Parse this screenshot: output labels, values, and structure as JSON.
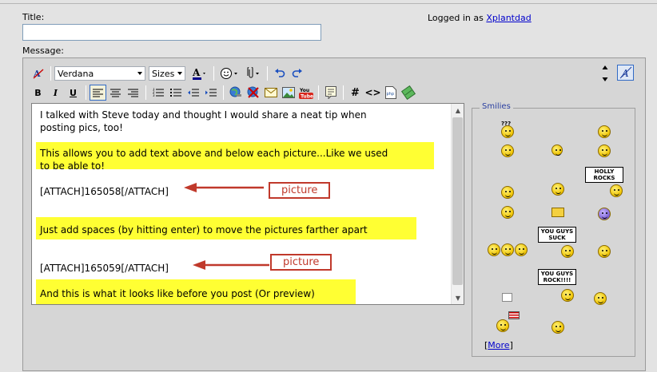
{
  "form": {
    "title_label": "Title:",
    "title_value": "",
    "message_label": "Message:",
    "logged_in_prefix": "Logged in as",
    "username": "Xplantdad"
  },
  "toolbar": {
    "font_name": "Verdana",
    "font_size": "Sizes",
    "bold": "B",
    "italic": "I",
    "underline": "U",
    "hash": "#",
    "code": "<>"
  },
  "message": {
    "line1a": "I talked with Steve today and thought I would share  a neat tip when",
    "line1b": "posting pics, too!",
    "line2a": "This allows you to add text above and below each picture...Like we used",
    "line2b": "to be able to!",
    "attach1": "[ATTACH]165058[/ATTACH]",
    "line3": "Just add spaces (by hitting enter)  to move the pictures farther apart",
    "attach2": "[ATTACH]165059[/ATTACH]",
    "line4": "And this is what it looks like before you post (Or preview)"
  },
  "callouts": {
    "label1": "picture",
    "label2": "picture"
  },
  "smilies": {
    "title": "Smilies",
    "more_prefix": "[",
    "more_link": "More",
    "more_suffix": "]",
    "sign_holly": "HOLLY ROCKS",
    "sign_suck": "YOU GUYS SUCK",
    "sign_rock": "YOU GUYS ROCK!!!!",
    "question": "???"
  },
  "colors": {
    "highlight": "#ffff33",
    "callout": "#c0392b",
    "link": "#0000cc"
  }
}
